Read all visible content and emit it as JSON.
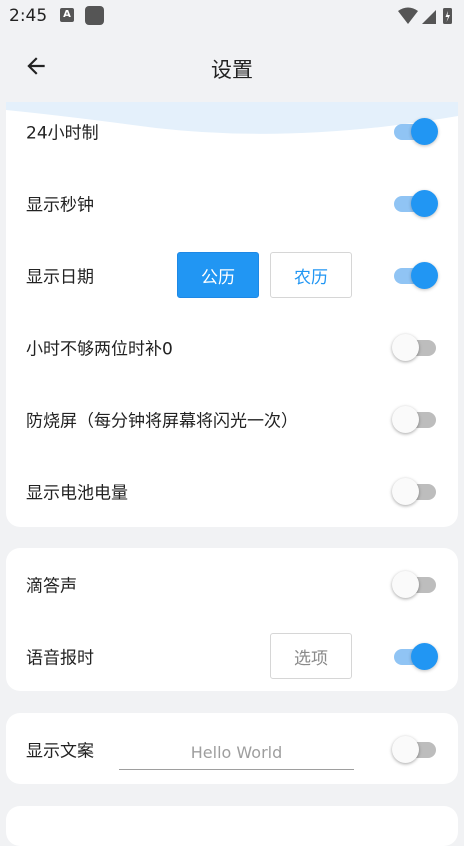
{
  "status_bar": {
    "time": "2:45",
    "notif_icon_letter": "A"
  },
  "app_bar": {
    "title": "设置"
  },
  "settings_group1": [
    {
      "label": "24小时制",
      "on": true
    },
    {
      "label": "显示秒钟",
      "on": true
    },
    {
      "label": "显示日期",
      "on": true,
      "options": [
        "公历",
        "农历"
      ],
      "selected": "公历"
    },
    {
      "label": "小时不够两位时补0",
      "on": false
    },
    {
      "label": "防烧屏（每分钟将屏幕将闪光一次）",
      "on": false
    },
    {
      "label": "显示电池电量",
      "on": false
    }
  ],
  "settings_group2": [
    {
      "label": "滴答声",
      "on": false
    },
    {
      "label": "语音报时",
      "on": true,
      "button_label": "选项"
    }
  ],
  "settings_group3": {
    "label": "显示文案",
    "input_placeholder": "Hello World",
    "on": false
  },
  "colors": {
    "accent": "#2196f3",
    "background": "#f1f2f4",
    "card": "#ffffff"
  }
}
